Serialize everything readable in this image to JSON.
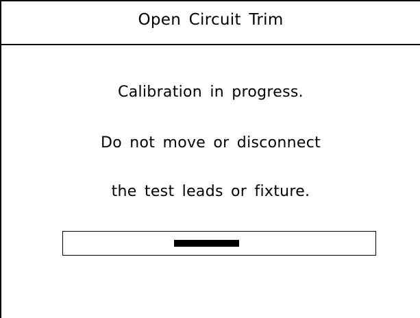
{
  "dialog": {
    "title": "Open Circuit Trim"
  },
  "message": {
    "line1": "Calibration in progress.",
    "line2": "Do not move or disconnect",
    "line3": "the test leads or fixture."
  },
  "progress": {
    "type": "indeterminate-busy-bar",
    "color": "#000000"
  },
  "colors": {
    "background": "#ffffff",
    "foreground": "#000000"
  }
}
